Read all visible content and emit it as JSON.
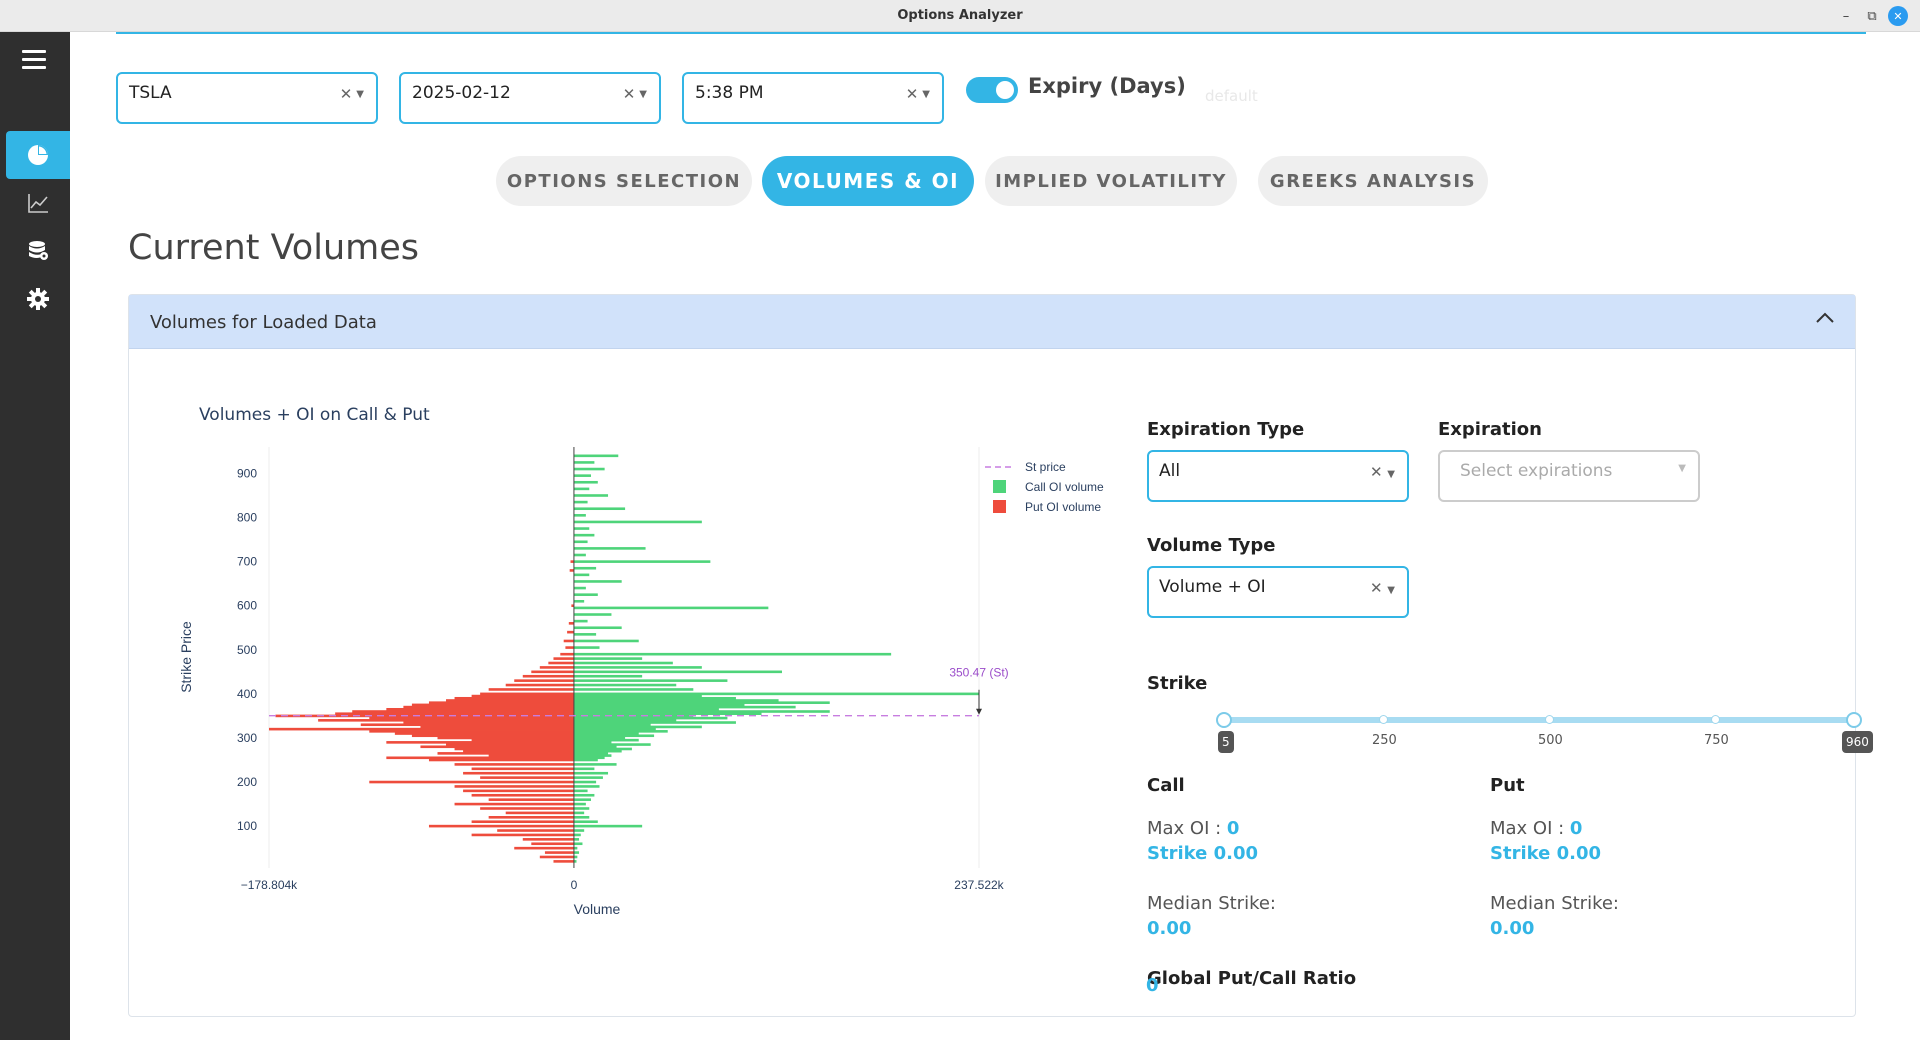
{
  "window": {
    "title": "Options Analyzer"
  },
  "filters": {
    "ticker": "TSLA",
    "date": "2025-02-12",
    "time": "5:38 PM",
    "toggle_label": "Expiry (Days)",
    "toggle_on": true,
    "ghost_label": "default"
  },
  "tabs": [
    {
      "label": "OPTIONS SELECTION",
      "active": false
    },
    {
      "label": "VOLUMES & OI",
      "active": true
    },
    {
      "label": "IMPLIED VOLATILITY",
      "active": false
    },
    {
      "label": "GREEKS ANALYSIS",
      "active": false
    }
  ],
  "page_title": "Current Volumes",
  "panel": {
    "header": "Volumes for Loaded Data",
    "chart_title": "Volumes + OI on Call & Put",
    "expiration_type_label": "Expiration Type",
    "expiration_type_value": "All",
    "expiration_label": "Expiration",
    "expiration_placeholder": "Select expirations",
    "volume_type_label": "Volume Type",
    "volume_type_value": "Volume + OI",
    "strike_label": "Strike",
    "strike_ticks": [
      "250",
      "500",
      "750"
    ],
    "strike_min": "5",
    "strike_max": "960",
    "call": {
      "heading": "Call",
      "max_oi_label": "Max OI : ",
      "max_oi_value": "0",
      "strike": "Strike 0.00",
      "median_label": "Median Strike:",
      "median_value": "0.00"
    },
    "put": {
      "heading": "Put",
      "max_oi_label": "Max OI : ",
      "max_oi_value": "0",
      "strike": "Strike 0.00",
      "median_label": "Median Strike:",
      "median_value": "0.00"
    },
    "ratio_label": "Global Put/Call Ratio",
    "ratio_value": "0"
  },
  "chart_data": {
    "type": "bar",
    "orientation": "horizontal",
    "title": "Volumes + OI on Call & Put",
    "xlabel": "Volume",
    "ylabel": "Strike Price",
    "xlim": [
      -178804,
      237522
    ],
    "ylim": [
      5,
      960
    ],
    "x_tick_labels": [
      "−178.804k",
      "0",
      "237.522k"
    ],
    "x_ticks": [
      -178804,
      0,
      237522
    ],
    "y_ticks": [
      100,
      200,
      300,
      400,
      500,
      600,
      700,
      800,
      900
    ],
    "legend": {
      "position": "top-right",
      "entries": [
        "St price",
        "Call OI volume",
        "Put OI volume"
      ]
    },
    "spot_price": {
      "value": 350.47,
      "label": "350.47 (St)"
    },
    "colors": {
      "call": "#4ed47a",
      "put": "#ee4c3c",
      "st_price": "#c77de0"
    },
    "series": [
      {
        "name": "Call OI volume",
        "strikes": [
          940,
          925,
          910,
          895,
          880,
          865,
          850,
          835,
          820,
          805,
          790,
          775,
          760,
          745,
          730,
          715,
          700,
          685,
          670,
          655,
          640,
          625,
          610,
          595,
          580,
          565,
          550,
          535,
          520,
          505,
          490,
          480,
          470,
          460,
          450,
          440,
          430,
          420,
          410,
          400,
          395,
          390,
          385,
          380,
          375,
          370,
          365,
          360,
          355,
          350,
          345,
          340,
          335,
          330,
          325,
          320,
          315,
          310,
          305,
          300,
          295,
          290,
          285,
          280,
          275,
          270,
          265,
          260,
          255,
          250,
          240,
          230,
          220,
          210,
          200,
          190,
          180,
          170,
          160,
          150,
          140,
          130,
          120,
          110,
          100,
          90,
          80,
          70,
          60,
          50,
          40,
          30,
          20
        ],
        "values": [
          26000,
          12000,
          18000,
          10000,
          14000,
          9000,
          20000,
          8000,
          30000,
          7000,
          75000,
          9000,
          12000,
          8000,
          42000,
          7000,
          80000,
          13000,
          9000,
          28000,
          7000,
          14000,
          6000,
          114000,
          22000,
          8000,
          28000,
          13000,
          38000,
          15000,
          186000,
          40000,
          58000,
          75000,
          122000,
          40000,
          90000,
          60000,
          70000,
          237522,
          75000,
          95000,
          120000,
          150000,
          100000,
          130000,
          85000,
          150000,
          110000,
          70000,
          90000,
          60000,
          95000,
          45000,
          75000,
          48000,
          55000,
          38000,
          47000,
          30000,
          38000,
          22000,
          45000,
          25000,
          34000,
          28000,
          20000,
          22000,
          18000,
          14000,
          25000,
          12000,
          20000,
          17000,
          13000,
          15000,
          8000,
          12000,
          10000,
          7000,
          9000,
          6000,
          9000,
          14000,
          40000,
          6000,
          4000,
          3000,
          5000,
          2000,
          3000,
          2000,
          1500
        ]
      },
      {
        "name": "Put OI volume",
        "strikes": [
          700,
          680,
          600,
          560,
          540,
          520,
          505,
          490,
          480,
          470,
          460,
          450,
          440,
          430,
          420,
          410,
          400,
          395,
          390,
          385,
          380,
          375,
          370,
          365,
          360,
          355,
          350,
          345,
          340,
          335,
          330,
          325,
          320,
          315,
          310,
          305,
          300,
          295,
          290,
          285,
          280,
          275,
          270,
          265,
          260,
          255,
          250,
          240,
          230,
          220,
          210,
          200,
          190,
          180,
          170,
          160,
          150,
          140,
          130,
          120,
          110,
          100,
          90,
          80,
          70,
          60,
          50,
          40,
          30,
          20
        ],
        "values": [
          2000,
          2500,
          1500,
          3000,
          4000,
          6000,
          5000,
          8000,
          12000,
          15000,
          20000,
          25000,
          30000,
          35000,
          40000,
          50000,
          55000,
          60000,
          70000,
          75000,
          85000,
          95000,
          100000,
          110000,
          130000,
          140000,
          175000,
          120000,
          150000,
          100000,
          125000,
          90000,
          178804,
          120000,
          105000,
          95000,
          80000,
          60000,
          110000,
          75000,
          90000,
          70000,
          65000,
          80000,
          50000,
          110000,
          85000,
          70000,
          60000,
          65000,
          55000,
          120000,
          70000,
          65000,
          60000,
          50000,
          70000,
          55000,
          40000,
          50000,
          60000,
          85000,
          45000,
          60000,
          30000,
          25000,
          35000,
          17000,
          20000,
          12000
        ]
      }
    ]
  }
}
